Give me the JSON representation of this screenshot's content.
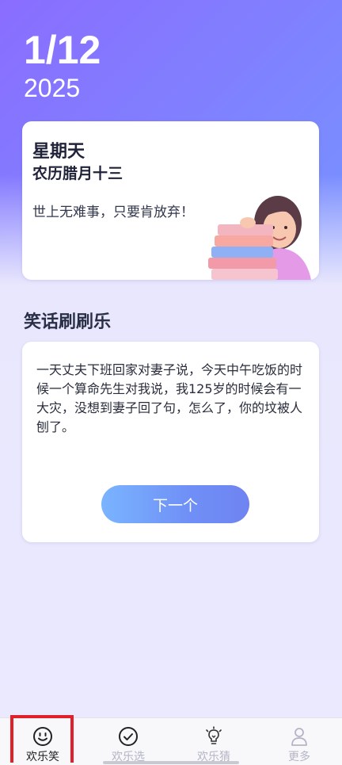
{
  "date": {
    "day": "1/12",
    "year": "2025"
  },
  "day_card": {
    "weekday": "星期天",
    "lunar": "农历腊月十三",
    "quote": "世上无难事，只要肯放弃！",
    "illustration_icon": "girl-with-books-illustration"
  },
  "joke": {
    "section_title": "笑话刷刷乐",
    "text": "一天丈夫下班回家对妻子说，今天中午吃饭的时候一个算命先生对我说，我125岁的时候会有一大灾，没想到妻子回了句，怎么了，你的坟被人刨了。",
    "next_label": "下一个"
  },
  "tabs": [
    {
      "label": "欢乐笑",
      "icon": "smile-icon",
      "active": true
    },
    {
      "label": "欢乐选",
      "icon": "check-circle-icon",
      "active": false
    },
    {
      "label": "欢乐猜",
      "icon": "lightbulb-icon",
      "active": false
    },
    {
      "label": "更多",
      "icon": "user-icon",
      "active": false
    }
  ],
  "colors": {
    "accent": "#6f8ff6",
    "highlight": "#e0202a"
  }
}
